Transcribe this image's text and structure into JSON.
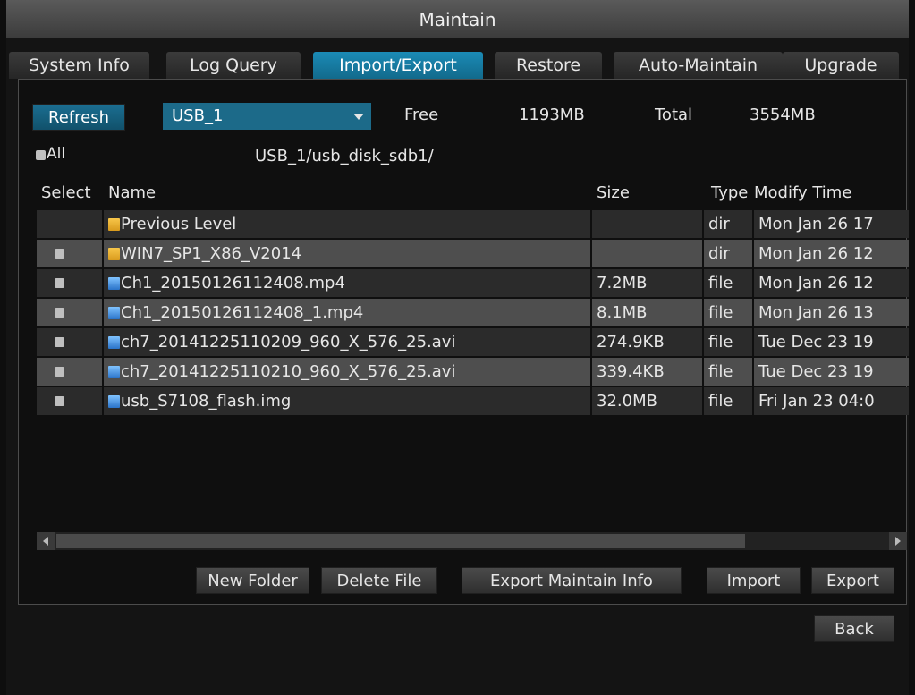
{
  "window": {
    "title": "Maintain"
  },
  "tabs": [
    {
      "label": "System Info"
    },
    {
      "label": "Log Query"
    },
    {
      "label": "Import/Export",
      "active": true
    },
    {
      "label": "Restore"
    },
    {
      "label": "Auto-Maintain"
    },
    {
      "label": "Upgrade"
    }
  ],
  "toolbar": {
    "refresh_label": "Refresh",
    "device_selected": "USB_1",
    "free_label": "Free",
    "free_value": "1193MB",
    "total_label": "Total",
    "total_value": "3554MB"
  },
  "path_bar": {
    "all_label": "All",
    "current_path": "USB_1/usb_disk_sdb1/"
  },
  "file_table": {
    "columns": [
      "Select",
      "Name",
      "Size",
      "Type",
      "Modify Time"
    ],
    "rows": [
      {
        "name": "Previous Level",
        "size": "",
        "type": "dir",
        "modified": "Mon Jan 26 17",
        "icon": "folder-up-icon",
        "has_checkbox": false
      },
      {
        "name": "WIN7_SP1_X86_V2014",
        "size": "",
        "type": "dir",
        "modified": "Mon Jan 26 12",
        "icon": "folder-icon",
        "has_checkbox": true
      },
      {
        "name": "Ch1_20150126112408.mp4",
        "size": "7.2MB",
        "type": "file",
        "modified": "Mon Jan 26 12",
        "icon": "file-icon",
        "has_checkbox": true
      },
      {
        "name": "Ch1_20150126112408_1.mp4",
        "size": "8.1MB",
        "type": "file",
        "modified": "Mon Jan 26 13",
        "icon": "file-icon",
        "has_checkbox": true
      },
      {
        "name": "ch7_20141225110209_960_X_576_25.avi",
        "size": "274.9KB",
        "type": "file",
        "modified": "Tue Dec 23 19",
        "icon": "file-icon",
        "has_checkbox": true
      },
      {
        "name": "ch7_20141225110210_960_X_576_25.avi",
        "size": "339.4KB",
        "type": "file",
        "modified": "Tue Dec 23 19",
        "icon": "file-icon",
        "has_checkbox": true
      },
      {
        "name": "usb_S7108_flash.img",
        "size": "32.0MB",
        "type": "file",
        "modified": "Fri Jan 23 04:0",
        "icon": "file-icon",
        "has_checkbox": true
      }
    ]
  },
  "actions": {
    "new_folder": "New Folder",
    "delete_file": "Delete File",
    "export_maintain_info": "Export Maintain Info",
    "import": "Import",
    "export": "Export",
    "back": "Back"
  },
  "colors": {
    "accent": "#1b8bb6",
    "background": "#0e0e0e"
  }
}
